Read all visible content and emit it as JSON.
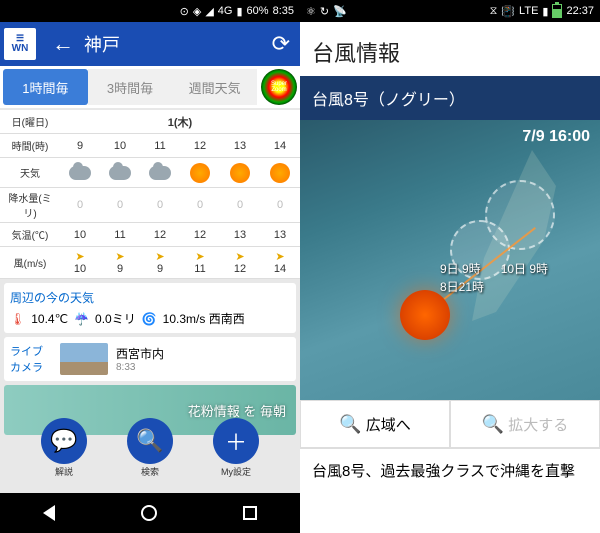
{
  "left": {
    "statusbar": {
      "signal": "◢",
      "net": "4G",
      "wifi": "▲",
      "battery": "60%",
      "time": "8:35"
    },
    "header": {
      "logo": "WN",
      "back": "←",
      "title": "神戸",
      "reload": "⟳"
    },
    "tabs": {
      "t1": "1時間毎",
      "t2": "3時間毎",
      "t3": "週間天気",
      "zoom": "Super Zoom"
    },
    "forecast": {
      "labels": {
        "date": "日(曜日)",
        "hour": "時間(時)",
        "weather": "天気",
        "precip": "降水量(ミリ)",
        "temp": "気温(℃)",
        "wind": "風(m/s)"
      },
      "date": "1(木)",
      "hours": [
        "9",
        "10",
        "11",
        "12",
        "13",
        "14"
      ],
      "weather": [
        "cloud",
        "cloud",
        "cloud",
        "sun",
        "sun",
        "sun"
      ],
      "precip": [
        "0",
        "0",
        "0",
        "0",
        "0",
        "0"
      ],
      "temp": [
        "10",
        "11",
        "12",
        "12",
        "13",
        "13"
      ],
      "wind": [
        "10",
        "9",
        "9",
        "11",
        "12",
        "14"
      ]
    },
    "around": {
      "title": "周辺の今の天気",
      "temp": "10.4℃",
      "rain": "0.0ミリ",
      "wind": "10.3m/s 西南西"
    },
    "live": {
      "label": "ライブカメラ",
      "place": "西宮市内",
      "time": "8:33"
    },
    "banner": {
      "text": "花粉情報 を 毎朝"
    },
    "nav": {
      "b1": "解説",
      "b2": "検索",
      "b3": "My設定"
    }
  },
  "right": {
    "statusbar": {
      "lte": "LTE",
      "time": "22:37"
    },
    "title": "台風情報",
    "name": "台風8号（ノグリー）",
    "timestamp": "7/9 16:00",
    "labels": {
      "l1": "9日 9時",
      "l2": "10日 9時",
      "l3": "8日21時"
    },
    "buttons": {
      "wide": "広域へ",
      "zoom": "拡大する"
    },
    "news": "台風8号、過去最強クラスで沖縄を直撃"
  }
}
